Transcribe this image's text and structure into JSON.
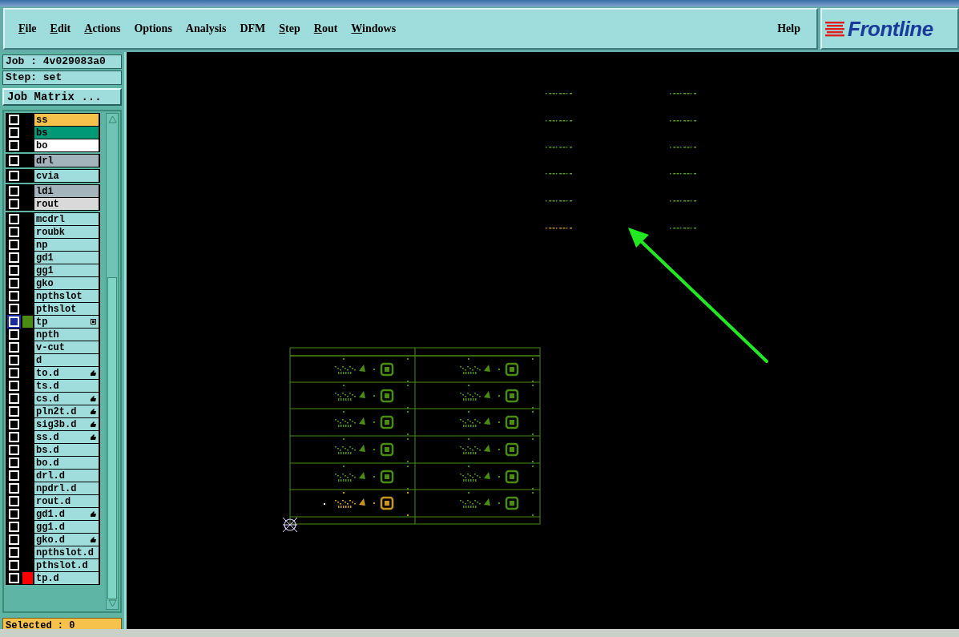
{
  "menu": [
    {
      "label": "File",
      "mnemonic": true
    },
    {
      "label": "Edit",
      "mnemonic": true
    },
    {
      "label": "Actions",
      "mnemonic": true
    },
    {
      "label": "Options",
      "mnemonic": false
    },
    {
      "label": "Analysis",
      "mnemonic": false
    },
    {
      "label": "DFM",
      "mnemonic": false
    },
    {
      "label": "Step",
      "mnemonic": true
    },
    {
      "label": "Rout",
      "mnemonic": true
    },
    {
      "label": "Windows",
      "mnemonic": true
    }
  ],
  "help": "Help",
  "logo": "Frontline",
  "job": "Job : 4v029083a0",
  "step": "Step: set",
  "job_matrix_button": "Job Matrix ...",
  "layer_groups": [
    [
      {
        "name": "ss",
        "color": "#f7c24c",
        "selected": false,
        "flagged": false
      },
      {
        "name": "bs",
        "color": "#009977",
        "selected": false,
        "flagged": false
      },
      {
        "name": "bo",
        "color": "#ffffff",
        "selected": false,
        "flagged": false
      }
    ],
    [
      {
        "name": "drl",
        "color": "#a3b4bc",
        "selected": false,
        "flagged": false
      }
    ],
    [
      {
        "name": "cvia",
        "color": "#9fdcdc",
        "selected": false,
        "flagged": false
      }
    ],
    [
      {
        "name": "ldi",
        "color": "#a3b4bc",
        "selected": false,
        "flagged": false
      },
      {
        "name": "rout",
        "color": "#d9d9d9",
        "selected": false,
        "flagged": false
      }
    ],
    [
      {
        "name": "mcdrl",
        "color": "#9fdcdc",
        "selected": false,
        "flagged": false
      },
      {
        "name": "roubk",
        "color": "#9fdcdc",
        "selected": false,
        "flagged": false
      },
      {
        "name": "np",
        "color": "#9fdcdc",
        "selected": false,
        "flagged": false
      },
      {
        "name": "gd1",
        "color": "#9fdcdc",
        "selected": false,
        "flagged": false
      },
      {
        "name": "gg1",
        "color": "#9fdcdc",
        "selected": false,
        "flagged": false
      },
      {
        "name": "gko",
        "color": "#9fdcdc",
        "selected": false,
        "flagged": false
      },
      {
        "name": "npthslot",
        "color": "#9fdcdc",
        "selected": false,
        "flagged": false
      },
      {
        "name": "pthslot",
        "color": "#9fdcdc",
        "selected": false,
        "flagged": false
      },
      {
        "name": "tp",
        "color": "#9fdcdc",
        "selected": true,
        "flagged": false,
        "swatch": {
          "color": "#4a8c12"
        }
      },
      {
        "name": "npth",
        "color": "#9fdcdc",
        "selected": false,
        "flagged": false
      },
      {
        "name": "v-cut",
        "color": "#9fdcdc",
        "selected": false,
        "flagged": false
      },
      {
        "name": "d",
        "color": "#9fdcdc",
        "selected": false,
        "flagged": false
      },
      {
        "name": "to.d",
        "color": "#9fdcdc",
        "selected": false,
        "flagged": true
      },
      {
        "name": "ts.d",
        "color": "#9fdcdc",
        "selected": false,
        "flagged": false
      },
      {
        "name": "cs.d",
        "color": "#9fdcdc",
        "selected": false,
        "flagged": true
      },
      {
        "name": "pln2t.d",
        "color": "#9fdcdc",
        "selected": false,
        "flagged": true
      },
      {
        "name": "sig3b.d",
        "color": "#9fdcdc",
        "selected": false,
        "flagged": true
      },
      {
        "name": "ss.d",
        "color": "#9fdcdc",
        "selected": false,
        "flagged": true
      },
      {
        "name": "bs.d",
        "color": "#9fdcdc",
        "selected": false,
        "flagged": false
      },
      {
        "name": "bo.d",
        "color": "#9fdcdc",
        "selected": false,
        "flagged": false
      },
      {
        "name": "drl.d",
        "color": "#9fdcdc",
        "selected": false,
        "flagged": false
      },
      {
        "name": "npdrl.d",
        "color": "#9fdcdc",
        "selected": false,
        "flagged": false
      },
      {
        "name": "rout.d",
        "color": "#9fdcdc",
        "selected": false,
        "flagged": false
      },
      {
        "name": "gd1.d",
        "color": "#9fdcdc",
        "selected": false,
        "flagged": true
      },
      {
        "name": "gg1.d",
        "color": "#9fdcdc",
        "selected": false,
        "flagged": false
      },
      {
        "name": "gko.d",
        "color": "#9fdcdc",
        "selected": false,
        "flagged": true
      },
      {
        "name": "npthslot.d",
        "color": "#9fdcdc",
        "selected": false,
        "flagged": false
      },
      {
        "name": "pthslot.d",
        "color": "#9fdcdc",
        "selected": false,
        "flagged": false
      },
      {
        "name": "tp.d",
        "color": "#9fdcdc",
        "selected": false,
        "flagged": false,
        "swatch": {
          "color": "#ff0000"
        }
      }
    ]
  ],
  "selected_count": "Selected : 0"
}
